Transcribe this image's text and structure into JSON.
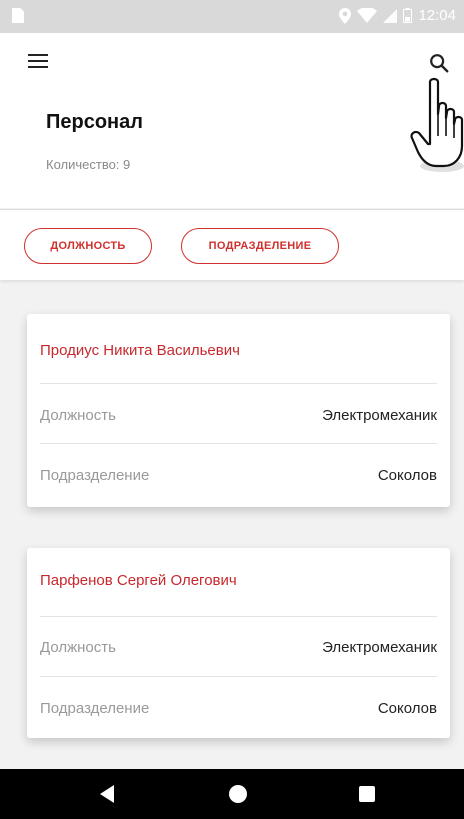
{
  "status_bar": {
    "time": "12:04",
    "icons": [
      "sim-card-icon",
      "location-icon",
      "wifi-icon",
      "signal-icon",
      "battery-icon"
    ]
  },
  "header": {
    "title": "Персонал",
    "count_label": "Количество: 9",
    "menu_icon": "hamburger-menu-icon",
    "search_icon": "search-icon"
  },
  "filters": {
    "position_label": "ДОЛЖНОСТЬ",
    "division_label": "ПОДРАЗДЕЛЕНИЕ"
  },
  "employees": [
    {
      "name": "Продиус Никита Васильевич",
      "position_label": "Должность",
      "position_value": "Электромеханик",
      "division_label": "Подразделение",
      "division_value": "Соколов"
    },
    {
      "name": "Парфенов Сергей Олегович",
      "position_label": "Должность",
      "position_value": "Электромеханик",
      "division_label": "Подразделение",
      "division_value": "Соколов"
    }
  ],
  "nav": {
    "back_icon": "back-triangle-icon",
    "home_icon": "home-circle-icon",
    "recent_icon": "recent-apps-square-icon"
  },
  "colors": {
    "accent": "#c8282d",
    "status_bar": "#d9d9d9",
    "nav_bar": "#000000"
  }
}
